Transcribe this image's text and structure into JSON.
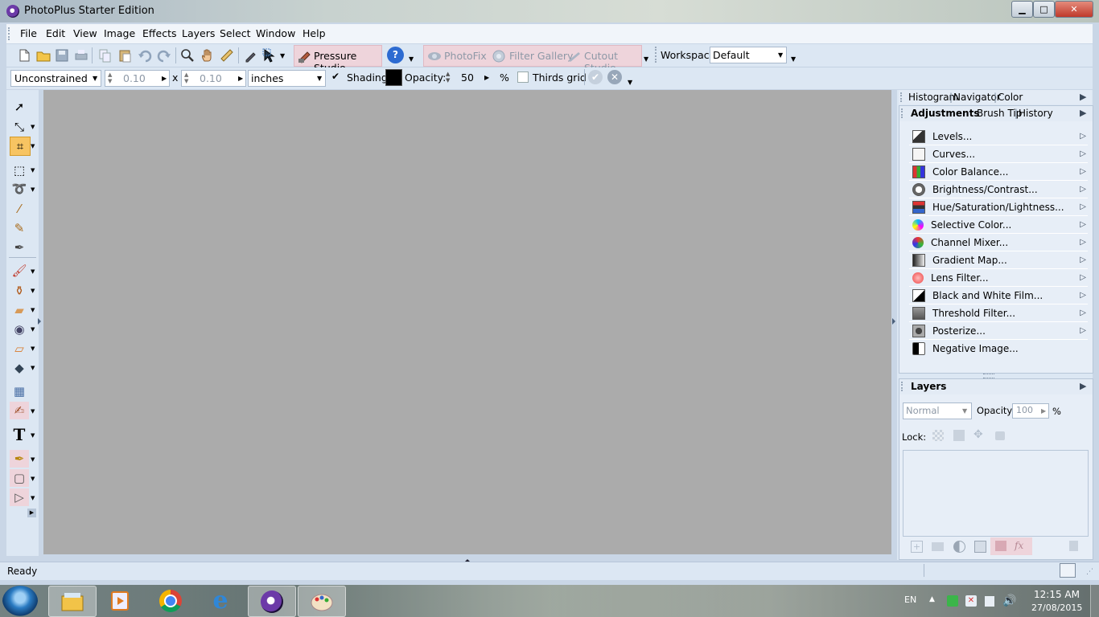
{
  "window": {
    "title": "PhotoPlus Starter Edition"
  },
  "caption_buttons": {
    "minimize": "▁",
    "maximize": "□",
    "close": "✕"
  },
  "menubar": [
    "File",
    "Edit",
    "View",
    "Image",
    "Effects",
    "Layers",
    "Select",
    "Window",
    "Help"
  ],
  "toolbar1": {
    "pressure_studio": "Pressure Studio",
    "photofix": "PhotoFix",
    "filter_gallery": "Filter Gallery",
    "cutout_studio": "Cutout Studio",
    "workspace_label": "Workspace",
    "workspace_value": "Default"
  },
  "toolbar2": {
    "constraint": "Unconstrained",
    "width": "0.10",
    "x_label": "x",
    "height": "0.10",
    "units": "inches",
    "shading_label": "Shading",
    "opacity_label": "Opacity:",
    "opacity_value": "50",
    "percent": "%",
    "thirds_grid_label": "Thirds grid"
  },
  "right_panel": {
    "tabs_top": [
      "Histogram",
      "Navigator",
      "Color"
    ],
    "tabs_second": [
      "Adjustments",
      "Brush Tip",
      "History"
    ],
    "adjustments": [
      {
        "label": "Levels...",
        "icon": "levels-icon"
      },
      {
        "label": "Curves...",
        "icon": "curves-icon"
      },
      {
        "label": "Color Balance...",
        "icon": "color-balance-icon"
      },
      {
        "label": "Brightness/Contrast...",
        "icon": "brightness-icon"
      },
      {
        "label": "Hue/Saturation/Lightness...",
        "icon": "hue-icon"
      },
      {
        "label": "Selective Color...",
        "icon": "selective-color-icon"
      },
      {
        "label": "Channel Mixer...",
        "icon": "channel-mixer-icon"
      },
      {
        "label": "Gradient Map...",
        "icon": "gradient-map-icon"
      },
      {
        "label": "Lens Filter...",
        "icon": "lens-filter-icon"
      },
      {
        "label": "Black and White Film...",
        "icon": "bw-film-icon"
      },
      {
        "label": "Threshold Filter...",
        "icon": "threshold-icon"
      },
      {
        "label": "Posterize...",
        "icon": "posterize-icon"
      },
      {
        "label": "Negative Image...",
        "icon": "negative-icon"
      }
    ],
    "layers": {
      "title": "Layers",
      "blend_mode": "Normal",
      "opacity_label": "Opacity:",
      "opacity_value": "100",
      "percent": "%",
      "lock_label": "Lock:"
    }
  },
  "statusbar": {
    "text": "Ready"
  },
  "taskbar": {
    "language": "EN",
    "time": "12:15 AM",
    "date": "27/08/2015"
  },
  "colors": {
    "canvas": "#ababab",
    "shading_swatch": "#000000"
  }
}
